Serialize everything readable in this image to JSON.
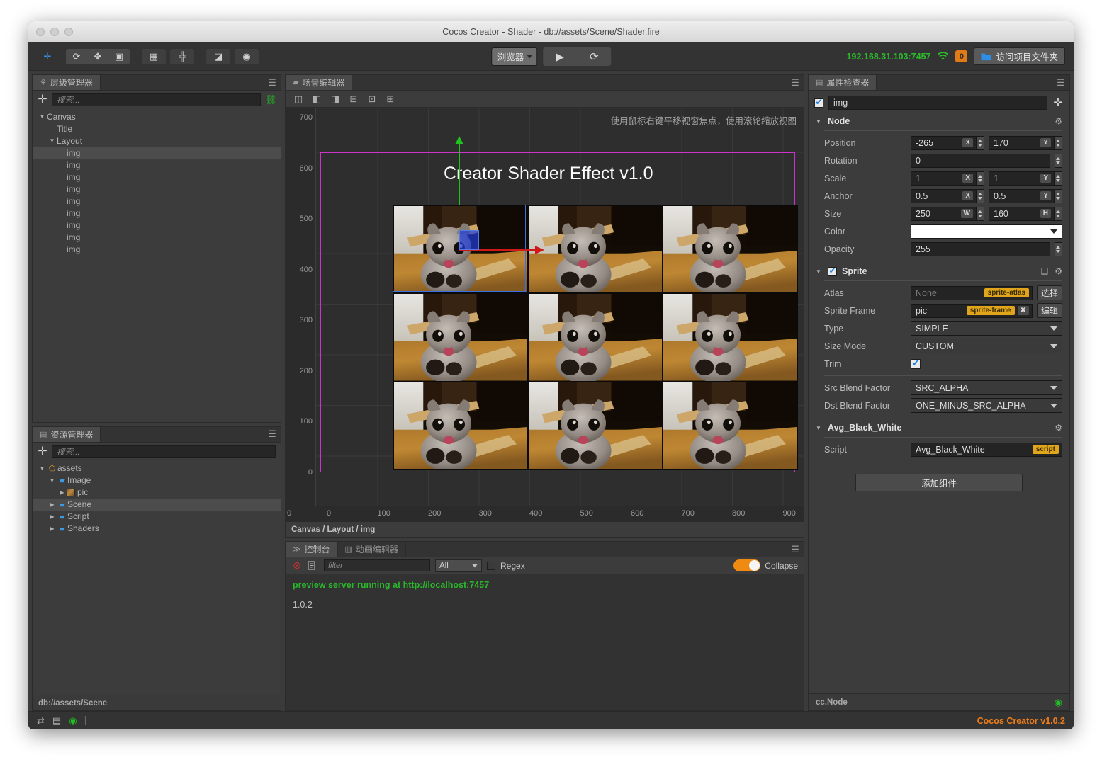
{
  "window": {
    "title": "Cocos Creator - Shader - db://assets/Scene/Shader.fire"
  },
  "toolbar": {
    "left_tools": [
      {
        "name": "move-tool",
        "glyph": "✛"
      },
      {
        "name": "rotate-tool",
        "glyph": "⟳"
      },
      {
        "name": "scale-tool",
        "glyph": "✥"
      },
      {
        "name": "rect-tool",
        "glyph": "▣"
      }
    ],
    "group2": [
      {
        "name": "align-tool",
        "glyph": "▦"
      },
      {
        "name": "distribute-tool",
        "glyph": "╬"
      }
    ],
    "group3": [
      {
        "name": "anchor-tool",
        "glyph": "◪"
      },
      {
        "name": "global-tool",
        "glyph": "◉"
      }
    ],
    "preview_target": "浏览器",
    "play_label": "▶",
    "refresh_label": "⟳",
    "ip_address": "192.168.31.103:7457",
    "notification_count": "0",
    "open_folder_label": "访问项目文件夹"
  },
  "hierarchy": {
    "tab_label": "层级管理器",
    "search_placeholder": "搜索...",
    "nodes": [
      {
        "label": "Canvas",
        "depth": 0,
        "arrow": "▼",
        "selected": false
      },
      {
        "label": "Title",
        "depth": 1,
        "arrow": "",
        "selected": false
      },
      {
        "label": "Layout",
        "depth": 1,
        "arrow": "▼",
        "selected": false
      },
      {
        "label": "img",
        "depth": 2,
        "arrow": "",
        "selected": true
      },
      {
        "label": "img",
        "depth": 2,
        "arrow": "",
        "selected": false
      },
      {
        "label": "img",
        "depth": 2,
        "arrow": "",
        "selected": false
      },
      {
        "label": "img",
        "depth": 2,
        "arrow": "",
        "selected": false
      },
      {
        "label": "img",
        "depth": 2,
        "arrow": "",
        "selected": false
      },
      {
        "label": "img",
        "depth": 2,
        "arrow": "",
        "selected": false
      },
      {
        "label": "img",
        "depth": 2,
        "arrow": "",
        "selected": false
      },
      {
        "label": "img",
        "depth": 2,
        "arrow": "",
        "selected": false
      },
      {
        "label": "img",
        "depth": 2,
        "arrow": "",
        "selected": false
      }
    ]
  },
  "assets": {
    "tab_label": "资源管理器",
    "search_placeholder": "搜索...",
    "nodes": [
      {
        "label": "assets",
        "depth": 0,
        "arrow": "▼",
        "icon": "assets",
        "selected": false
      },
      {
        "label": "Image",
        "depth": 1,
        "arrow": "▼",
        "icon": "folder",
        "selected": false
      },
      {
        "label": "pic",
        "depth": 2,
        "arrow": "▶",
        "icon": "pic",
        "selected": false
      },
      {
        "label": "Scene",
        "depth": 1,
        "arrow": "▶",
        "icon": "folder",
        "selected": true
      },
      {
        "label": "Script",
        "depth": 1,
        "arrow": "▶",
        "icon": "folder",
        "selected": false
      },
      {
        "label": "Shaders",
        "depth": 1,
        "arrow": "▶",
        "icon": "folder",
        "selected": false
      }
    ],
    "footer_path": "db://assets/Scene"
  },
  "scene": {
    "tab_label": "场景编辑器",
    "align_tools": [
      {
        "name": "align-left-icon",
        "glyph": "◫"
      },
      {
        "name": "align-center-h-icon",
        "glyph": "◧"
      },
      {
        "name": "align-right-icon",
        "glyph": "◨"
      },
      {
        "name": "align-top-icon",
        "glyph": "⊟"
      },
      {
        "name": "align-middle-v-icon",
        "glyph": "⊡"
      },
      {
        "name": "align-bottom-icon",
        "glyph": "⊞"
      }
    ],
    "hint": "使用鼠标右键平移视窗焦点，使用滚轮缩放视图",
    "title_text": "Creator Shader Effect v1.0",
    "ruler_v_ticks": [
      "700",
      "600",
      "500",
      "400",
      "300",
      "200",
      "100",
      "0"
    ],
    "ruler_h_ticks": [
      "0",
      "0",
      "100",
      "200",
      "300",
      "400",
      "500",
      "600",
      "700",
      "800",
      "900"
    ],
    "breadcrumb": "Canvas / Layout / img",
    "image_cells": 9
  },
  "console": {
    "tabs": [
      {
        "label": "控制台",
        "active": true
      },
      {
        "label": "动画编辑器",
        "active": false
      }
    ],
    "clear_icon": "⊘",
    "copy_icon": "🗏",
    "filter_placeholder": "filter",
    "level_value": "All",
    "regex_label": "Regex",
    "collapse_label": "Collapse",
    "collapse_on": true,
    "messages": [
      {
        "text": "preview server running at http://localhost:7457",
        "type": "info"
      },
      {
        "text": "1.0.2",
        "type": "log"
      }
    ]
  },
  "inspector": {
    "tab_label": "属性检查器",
    "node_name": "img",
    "node_section": {
      "title": "Node",
      "position_label": "Position",
      "position_x": "-265",
      "position_y": "170",
      "rotation_label": "Rotation",
      "rotation": "0",
      "scale_label": "Scale",
      "scale_x": "1",
      "scale_y": "1",
      "anchor_label": "Anchor",
      "anchor_x": "0.5",
      "anchor_y": "0.5",
      "size_label": "Size",
      "size_w": "250",
      "size_h": "160",
      "color_label": "Color",
      "color_value": "#ffffff",
      "opacity_label": "Opacity",
      "opacity": "255",
      "axis_x": "X",
      "axis_y": "Y",
      "axis_w": "W",
      "axis_h": "H"
    },
    "sprite_section": {
      "title": "Sprite",
      "atlas_label": "Atlas",
      "atlas_value": "None",
      "atlas_tag": "sprite-atlas",
      "atlas_button": "选择",
      "sprite_frame_label": "Sprite Frame",
      "sprite_frame_value": "pic",
      "sprite_frame_tag": "sprite-frame",
      "sprite_frame_button": "编辑",
      "type_label": "Type",
      "type_value": "SIMPLE",
      "size_mode_label": "Size Mode",
      "size_mode_value": "CUSTOM",
      "trim_label": "Trim",
      "trim_checked": true,
      "src_blend_label": "Src Blend Factor",
      "src_blend_value": "SRC_ALPHA",
      "dst_blend_label": "Dst Blend Factor",
      "dst_blend_value": "ONE_MINUS_SRC_ALPHA"
    },
    "script_section": {
      "title": "Avg_Black_White",
      "script_label": "Script",
      "script_value": "Avg_Black_White",
      "script_tag": "script"
    },
    "add_component_label": "添加组件",
    "footer_type": "cc.Node"
  },
  "statusbar": {
    "icons": [
      {
        "name": "sync-icon",
        "glyph": "⇄"
      },
      {
        "name": "database-icon",
        "glyph": "▤"
      },
      {
        "name": "eye-icon",
        "glyph": "◉"
      }
    ],
    "version": "Cocos Creator v1.0.2"
  },
  "colors": {
    "accent_orange": "#ef7d18",
    "accent_green": "#2cbb2c",
    "accent_blue": "#3b8fe0",
    "canvas_outline": "#cc33cc",
    "tag_yellow": "#e0a51a"
  }
}
